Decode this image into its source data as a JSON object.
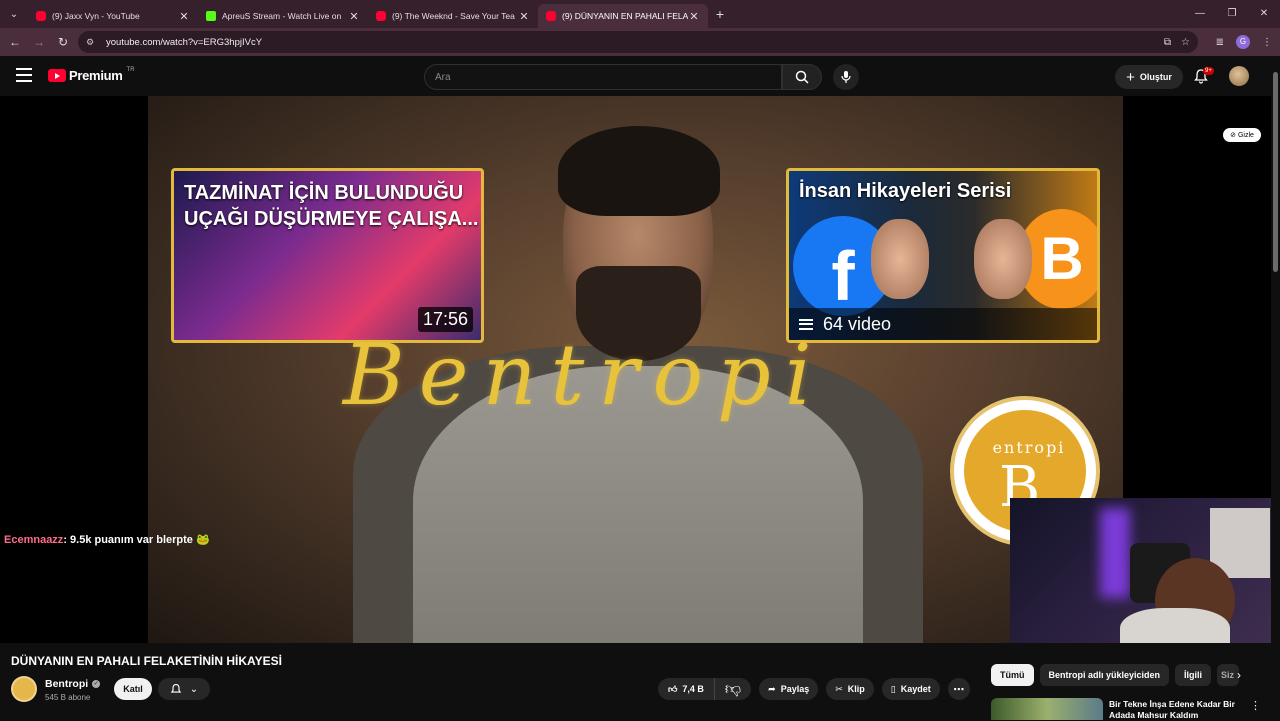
{
  "browser": {
    "tabs": [
      {
        "title": "(9) Jaxx Vyn - YouTube",
        "favicon": "youtube-icon",
        "active": false
      },
      {
        "title": "ApreuS Stream - Watch Live on",
        "favicon": "kick-icon",
        "active": false
      },
      {
        "title": "(9) The Weeknd - Save Your Tea",
        "favicon": "youtube-icon",
        "active": false
      },
      {
        "title": "(9) DÜNYANIN EN PAHALI FELA",
        "favicon": "youtube-icon",
        "active": true
      }
    ],
    "url": "youtube.com/watch?v=ERG3hpjIVcY",
    "profile_initial": "G"
  },
  "youtube": {
    "logo_text": "Premium",
    "country_code": "TR",
    "search_placeholder": "Ara",
    "create_label": "Oluştur",
    "notifications_badge": "9+"
  },
  "player": {
    "end_cards": [
      {
        "title": "TAZMİNAT İÇİN BULUNDUĞU UÇAĞI DÜŞÜRMEYE ÇALIŞA...",
        "duration": "17:56"
      },
      {
        "title": "İnsan Hikayeleri Serisi",
        "count": "64 video"
      }
    ],
    "watermark_text": "Bentropi",
    "channel_logo_text": "entropi",
    "hide_label": "Gizle",
    "chat_overlay": {
      "user": "Ecemnaazz",
      "message": ": 9.5k puanım var blerpte 🐸"
    }
  },
  "video": {
    "title": "DÜNYANIN EN PAHALI FELAKETİNİN HİKAYESİ",
    "channel_name": "Bentropi",
    "subscribers": "545 B abone",
    "join_label": "Katıl",
    "likes": "7,4 B",
    "share_label": "Paylaş",
    "clip_label": "Klip",
    "save_label": "Kaydet"
  },
  "sidebar": {
    "chips": [
      "Tümü",
      "Bentropi adlı yükleyiciden",
      "İlgili",
      "Siz"
    ],
    "recommendation_title": "Bir Tekne İnşa Edene Kadar Bir Adada Mahsur Kaldım"
  },
  "colors": {
    "youtube_red": "#ff0033",
    "browser_frame": "#35202c",
    "accent_gold": "#e2b93a"
  }
}
